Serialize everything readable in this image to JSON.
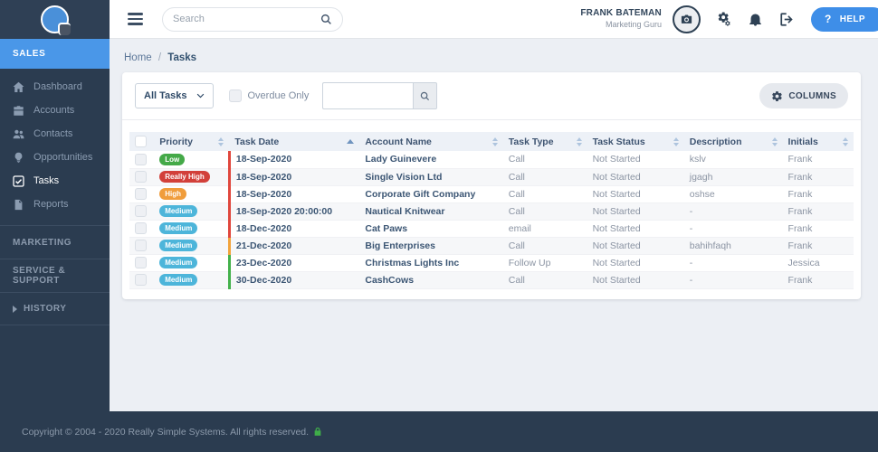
{
  "header": {
    "search_placeholder": "Search",
    "user": {
      "name": "FRANK BATEMAN",
      "role": "Marketing Guru"
    },
    "help_q": "?",
    "help_label": "HELP"
  },
  "sidebar": {
    "sales_label": "SALES",
    "items": [
      {
        "label": "Dashboard",
        "icon": "home-icon",
        "active": false
      },
      {
        "label": "Accounts",
        "icon": "briefcase-icon",
        "active": false
      },
      {
        "label": "Contacts",
        "icon": "users-icon",
        "active": false
      },
      {
        "label": "Opportunities",
        "icon": "lightbulb-icon",
        "active": false
      },
      {
        "label": "Tasks",
        "icon": "check-square-icon",
        "active": true
      },
      {
        "label": "Reports",
        "icon": "report-icon",
        "active": false
      }
    ],
    "sections": [
      {
        "label": "MARKETING"
      },
      {
        "label": "SERVICE & SUPPORT"
      },
      {
        "label": "HISTORY",
        "expandable": true
      }
    ]
  },
  "breadcrumb": {
    "home": "Home",
    "separator": "/",
    "current": "Tasks"
  },
  "filters": {
    "task_filter_value": "All Tasks",
    "overdue_label": "Overdue Only",
    "overdue_checked": false,
    "search_value": "",
    "columns_label": "COLUMNS"
  },
  "table": {
    "columns": [
      {
        "label": "Priority",
        "sort": "both"
      },
      {
        "label": "Task Date",
        "sort": "asc"
      },
      {
        "label": "Account Name",
        "sort": "both"
      },
      {
        "label": "Task Type",
        "sort": "both"
      },
      {
        "label": "Task Status",
        "sort": "both"
      },
      {
        "label": "Description",
        "sort": "both"
      },
      {
        "label": "Initials",
        "sort": "both"
      }
    ],
    "priority_colors": {
      "Low": "#44a948",
      "Really High": "#d2403a",
      "High": "#f09d3c",
      "Medium": "#4db5da"
    },
    "overdue_colors": {
      "red": "#e0473d",
      "orange": "#f2a33c",
      "green": "#43b14b"
    },
    "rows": [
      {
        "priority": "Low",
        "date": "18-Sep-2020",
        "bar": "red",
        "account": "Lady Guinevere",
        "type": "Call",
        "status": "Not Started",
        "description": "kslv",
        "initials": "Frank"
      },
      {
        "priority": "Really High",
        "date": "18-Sep-2020",
        "bar": "red",
        "account": "Single Vision Ltd",
        "type": "Call",
        "status": "Not Started",
        "description": "jgagh",
        "initials": "Frank"
      },
      {
        "priority": "High",
        "date": "18-Sep-2020",
        "bar": "red",
        "account": "Corporate Gift Company",
        "type": "Call",
        "status": "Not Started",
        "description": "oshse",
        "initials": "Frank"
      },
      {
        "priority": "Medium",
        "date": "18-Sep-2020 20:00:00",
        "bar": "red",
        "account": "Nautical Knitwear",
        "type": "Call",
        "status": "Not Started",
        "description": "-",
        "initials": "Frank"
      },
      {
        "priority": "Medium",
        "date": "18-Dec-2020",
        "bar": "red",
        "account": "Cat Paws",
        "type": "email",
        "status": "Not Started",
        "description": "-",
        "initials": "Frank"
      },
      {
        "priority": "Medium",
        "date": "21-Dec-2020",
        "bar": "orange",
        "account": "Big Enterprises",
        "type": "Call",
        "status": "Not Started",
        "description": "bahihfaqh",
        "initials": "Frank"
      },
      {
        "priority": "Medium",
        "date": "23-Dec-2020",
        "bar": "green",
        "account": "Christmas Lights Inc",
        "type": "Follow Up",
        "status": "Not Started",
        "description": "-",
        "initials": "Jessica"
      },
      {
        "priority": "Medium",
        "date": "30-Dec-2020",
        "bar": "green",
        "account": "CashCows",
        "type": "Call",
        "status": "Not Started",
        "description": "-",
        "initials": "Frank"
      }
    ]
  },
  "footer": {
    "copyright": "Copyright © 2004 - 2020 Really Simple Systems. All rights reserved."
  },
  "colors": {
    "sidebar_bg": "#2b3c50",
    "active_section_bg": "#4a97e8",
    "help_button_bg": "#3e8ee8",
    "logo_blue": "#4a90d9",
    "table_header_bg": "#edf1f7",
    "content_bg": "#eceff4"
  }
}
